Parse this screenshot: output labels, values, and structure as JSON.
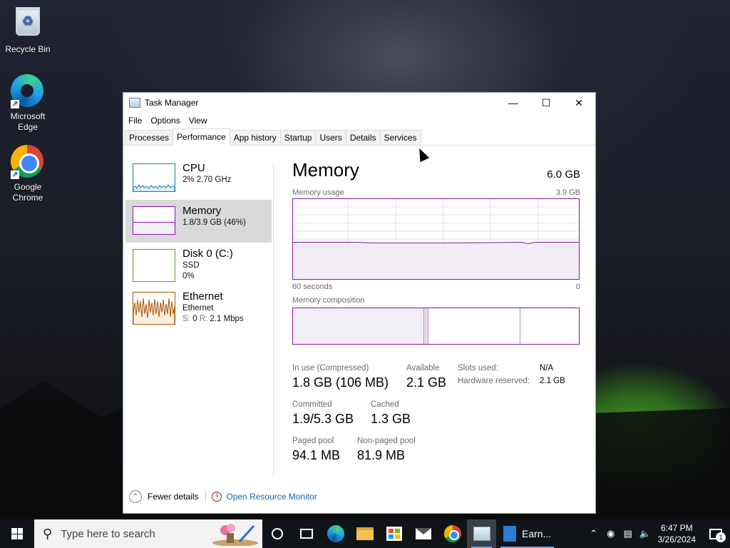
{
  "desktop": {
    "icons": [
      {
        "label": "Recycle Bin",
        "icon": "recycle-bin-icon"
      },
      {
        "label": "Microsoft Edge",
        "icon": "edge-icon"
      },
      {
        "label": "Google Chrome",
        "icon": "chrome-icon"
      }
    ]
  },
  "window": {
    "title": "Task Manager",
    "menu": [
      "File",
      "Options",
      "View"
    ],
    "tabs": [
      "Processes",
      "Performance",
      "App history",
      "Startup",
      "Users",
      "Details",
      "Services"
    ],
    "active_tab": "Performance"
  },
  "sidebar": {
    "items": [
      {
        "title": "CPU",
        "sub": "2%  2.70 GHz",
        "color": "#117dbb"
      },
      {
        "title": "Memory",
        "sub": "1.8/3.9 GB (46%)",
        "color": "#8b12ae",
        "selected": true
      },
      {
        "title": "Disk 0 (C:)",
        "sub": "SSD",
        "sub2": "0%",
        "color": "#4da60c"
      },
      {
        "title": "Ethernet",
        "sub": "Ethernet",
        "sub2_prefix_s": "S:",
        "sub2_s": "0",
        "sub2_prefix_r": "R:",
        "sub2_r": "2.1 Mbps",
        "color": "#a74f01"
      }
    ]
  },
  "memory": {
    "title": "Memory",
    "capacity": "6.0 GB",
    "usage_label": "Memory usage",
    "usage_max": "3.9 GB",
    "time_label": "60 seconds",
    "time_end": "0",
    "usage_fraction": 0.46,
    "composition_label": "Memory composition",
    "composition": {
      "in_use": 0.46,
      "modified": 0.015,
      "standby": 0.32,
      "free": 0.205
    },
    "stats": {
      "in_use_label": "In use (Compressed)",
      "in_use_value": "1.8 GB (106 MB)",
      "available_label": "Available",
      "available_value": "2.1 GB",
      "committed_label": "Committed",
      "committed_value": "1.9/5.3 GB",
      "cached_label": "Cached",
      "cached_value": "1.3 GB",
      "paged_label": "Paged pool",
      "paged_value": "94.1 MB",
      "nonpaged_label": "Non-paged pool",
      "nonpaged_value": "81.9 MB",
      "slots_label": "Slots used:",
      "slots_value": "N/A",
      "hw_label": "Hardware reserved:",
      "hw_value": "2.1 GB"
    },
    "accent": "#8b12ae"
  },
  "footer": {
    "fewer": "Fewer details",
    "resource_monitor": "Open Resource Monitor"
  },
  "taskbar": {
    "search_placeholder": "Type here to search",
    "running_app_label": "Earn...",
    "time": "6:47 PM",
    "date": "3/26/2024",
    "notification_count": "1"
  }
}
